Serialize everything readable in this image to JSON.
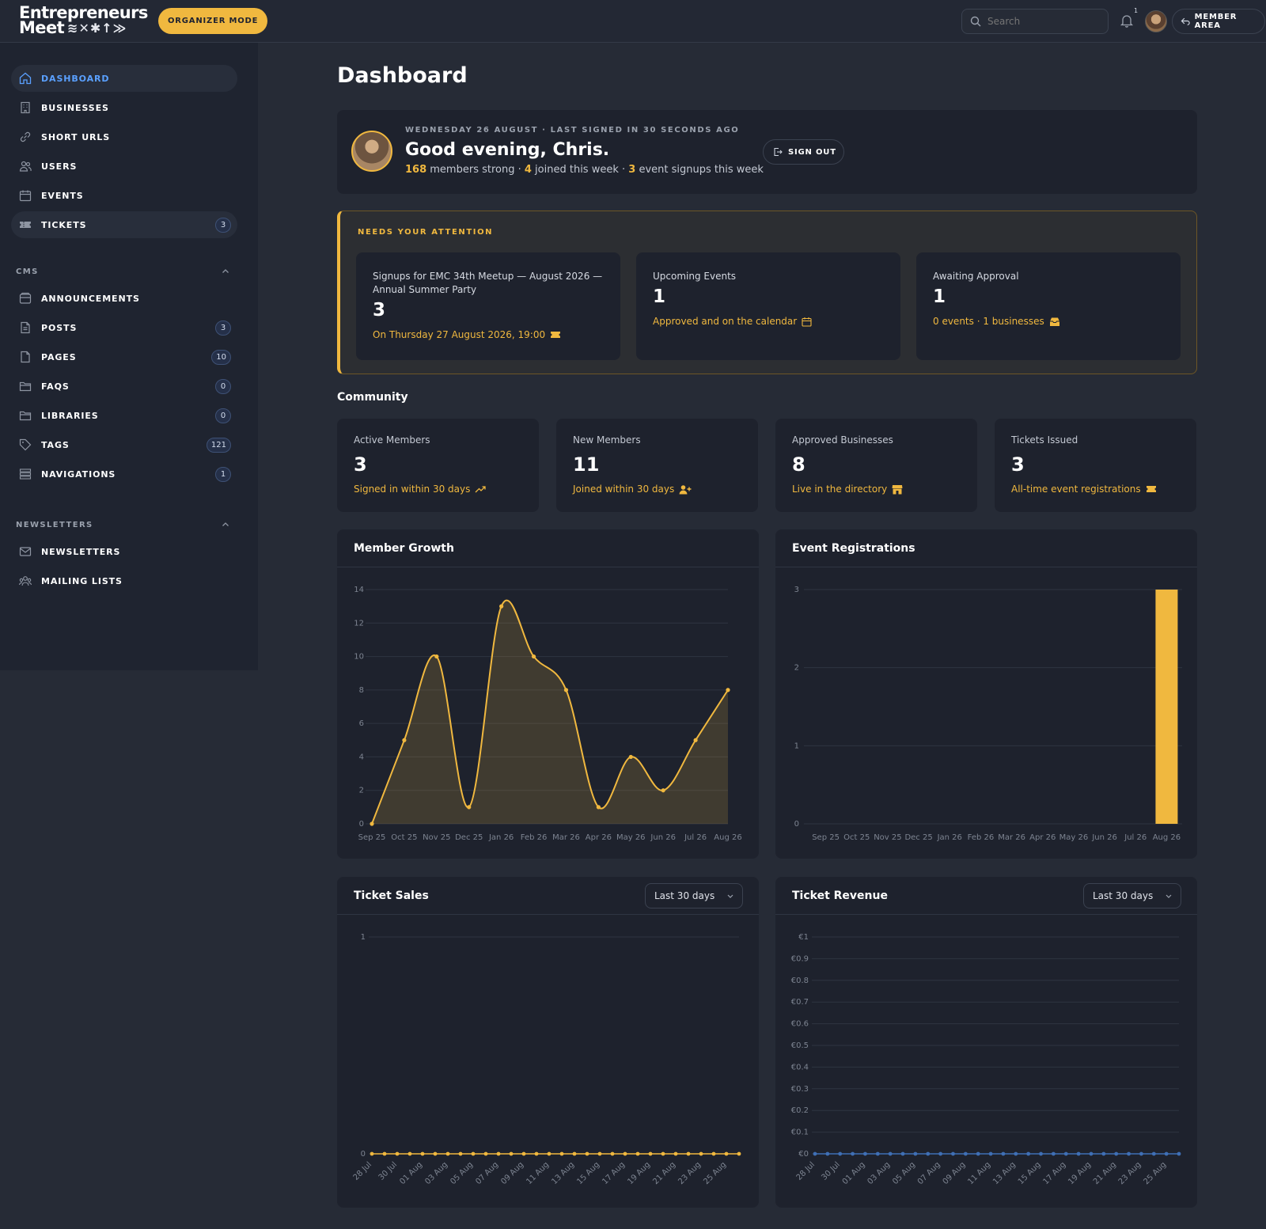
{
  "topbar": {
    "logo_line1": "Entrepreneurs",
    "logo_line2": "Meet",
    "logo_marks": "≋✕✱↑≫",
    "organizer_label": "ORGANIZER MODE",
    "search_placeholder": "Search",
    "notification_count": "1",
    "member_area_label": "MEMBER AREA"
  },
  "sidebar": {
    "main": [
      {
        "label": "DASHBOARD",
        "icon": "home-icon"
      },
      {
        "label": "BUSINESSES",
        "icon": "building-icon"
      },
      {
        "label": "SHORT URLS",
        "icon": "link-icon"
      },
      {
        "label": "USERS",
        "icon": "users-icon"
      },
      {
        "label": "EVENTS",
        "icon": "calendar-icon"
      },
      {
        "label": "TICKETS",
        "icon": "ticket-icon",
        "badge": "3"
      }
    ],
    "cms_heading": "CMS",
    "cms": [
      {
        "label": "ANNOUNCEMENTS",
        "icon": "inbox-icon"
      },
      {
        "label": "POSTS",
        "icon": "document-icon",
        "badge": "3"
      },
      {
        "label": "PAGES",
        "icon": "page-icon",
        "badge": "10"
      },
      {
        "label": "FAQS",
        "icon": "folder-icon",
        "badge": "0"
      },
      {
        "label": "LIBRARIES",
        "icon": "folder-icon",
        "badge": "0"
      },
      {
        "label": "TAGS",
        "icon": "tag-icon",
        "badge": "121"
      },
      {
        "label": "NAVIGATIONS",
        "icon": "list-icon",
        "badge": "1"
      }
    ],
    "newsletters_heading": "NEWSLETTERS",
    "newsletters": [
      {
        "label": "NEWSLETTERS",
        "icon": "mail-icon"
      },
      {
        "label": "MAILING LISTS",
        "icon": "group-icon"
      }
    ]
  },
  "main": {
    "title": "Dashboard",
    "welcome": {
      "kicker": "WEDNESDAY 26 AUGUST · LAST SIGNED IN 30 SECONDS AGO",
      "greeting": "Good evening, Chris.",
      "members": "168",
      "members_text": " members strong · ",
      "joined": "4",
      "joined_text": " joined this week · ",
      "signups": "3",
      "signups_text": " event signups this week",
      "sign_out_label": "SIGN OUT"
    },
    "attention": {
      "title": "NEEDS YOUR ATTENTION",
      "cards": [
        {
          "label": "Signups for EMC 34th Meetup — August 2026 — Annual Summer Party",
          "value": "3",
          "sub": "On Thursday 27 August 2026, 19:00",
          "icon": "ticket-icon"
        },
        {
          "label": "Upcoming Events",
          "value": "1",
          "sub": "Approved and on the calendar",
          "icon": "calendar-icon"
        },
        {
          "label": "Awaiting Approval",
          "value": "1",
          "sub": "0 events · 1 businesses",
          "icon": "inbox-icon"
        }
      ]
    },
    "community": {
      "title": "Community",
      "stats": [
        {
          "label": "Active Members",
          "value": "3",
          "sub": "Signed in within 30 days",
          "icon": "trend-up-icon"
        },
        {
          "label": "New Members",
          "value": "11",
          "sub": "Joined within 30 days",
          "icon": "user-plus-icon"
        },
        {
          "label": "Approved Businesses",
          "value": "8",
          "sub": "Live in the directory",
          "icon": "store-icon"
        },
        {
          "label": "Tickets Issued",
          "value": "3",
          "sub": "All-time event registrations",
          "icon": "ticket-icon"
        }
      ]
    },
    "charts": {
      "member_growth_title": "Member Growth",
      "event_registrations_title": "Event Registrations",
      "ticket_sales_title": "Ticket Sales",
      "ticket_revenue_title": "Ticket Revenue",
      "range_label": "Last 30 days"
    }
  },
  "colors": {
    "accent": "#f0b83f",
    "link_active": "#5aa0ff",
    "background": "#262b36",
    "card": "#1e222d",
    "revenue_line": "#3f6fb5"
  },
  "chart_data": [
    {
      "type": "area",
      "title": "Member Growth",
      "x": [
        "Sep 25",
        "Oct 25",
        "Nov 25",
        "Dec 25",
        "Jan 26",
        "Feb 26",
        "Mar 26",
        "Apr 26",
        "May 26",
        "Jun 26",
        "Jul 26",
        "Aug 26"
      ],
      "values": [
        0,
        5,
        10,
        1,
        13,
        10,
        8,
        1,
        4,
        2,
        5,
        8
      ],
      "ylim": [
        0,
        14
      ],
      "yticks": [
        0,
        2,
        4,
        6,
        8,
        10,
        12,
        14
      ],
      "grid": true
    },
    {
      "type": "bar",
      "title": "Event Registrations",
      "categories": [
        "Sep 25",
        "Oct 25",
        "Nov 25",
        "Dec 25",
        "Jan 26",
        "Feb 26",
        "Mar 26",
        "Apr 26",
        "May 26",
        "Jun 26",
        "Jul 26",
        "Aug 26"
      ],
      "values": [
        0,
        0,
        0,
        0,
        0,
        0,
        0,
        0,
        0,
        0,
        0,
        3
      ],
      "ylim": [
        0,
        3
      ],
      "yticks": [
        0,
        1,
        2,
        3
      ],
      "grid": true
    },
    {
      "type": "line",
      "title": "Ticket Sales",
      "x": [
        "28 Jul",
        "29 Jul",
        "30 Jul",
        "31 Jul",
        "01 Aug",
        "02 Aug",
        "03 Aug",
        "04 Aug",
        "05 Aug",
        "06 Aug",
        "07 Aug",
        "08 Aug",
        "09 Aug",
        "10 Aug",
        "11 Aug",
        "12 Aug",
        "13 Aug",
        "14 Aug",
        "15 Aug",
        "16 Aug",
        "17 Aug",
        "18 Aug",
        "19 Aug",
        "20 Aug",
        "21 Aug",
        "22 Aug",
        "23 Aug",
        "24 Aug",
        "25 Aug",
        "26 Aug"
      ],
      "xticks": [
        "28 Jul",
        "30 Jul",
        "01 Aug",
        "03 Aug",
        "05 Aug",
        "07 Aug",
        "09 Aug",
        "11 Aug",
        "13 Aug",
        "15 Aug",
        "17 Aug",
        "19 Aug",
        "21 Aug",
        "23 Aug",
        "25 Aug"
      ],
      "values": [
        0,
        0,
        0,
        0,
        0,
        0,
        0,
        0,
        0,
        0,
        0,
        0,
        0,
        0,
        0,
        0,
        0,
        0,
        0,
        0,
        0,
        0,
        0,
        0,
        0,
        0,
        0,
        0,
        0,
        0
      ],
      "ylim": [
        0,
        1
      ],
      "yticks": [
        0,
        1
      ],
      "grid": true
    },
    {
      "type": "line",
      "title": "Ticket Revenue",
      "x": [
        "28 Jul",
        "29 Jul",
        "30 Jul",
        "31 Jul",
        "01 Aug",
        "02 Aug",
        "03 Aug",
        "04 Aug",
        "05 Aug",
        "06 Aug",
        "07 Aug",
        "08 Aug",
        "09 Aug",
        "10 Aug",
        "11 Aug",
        "12 Aug",
        "13 Aug",
        "14 Aug",
        "15 Aug",
        "16 Aug",
        "17 Aug",
        "18 Aug",
        "19 Aug",
        "20 Aug",
        "21 Aug",
        "22 Aug",
        "23 Aug",
        "24 Aug",
        "25 Aug",
        "26 Aug"
      ],
      "xticks": [
        "28 Jul",
        "30 Jul",
        "01 Aug",
        "03 Aug",
        "05 Aug",
        "07 Aug",
        "09 Aug",
        "11 Aug",
        "13 Aug",
        "15 Aug",
        "17 Aug",
        "19 Aug",
        "21 Aug",
        "23 Aug",
        "25 Aug"
      ],
      "values": [
        0,
        0,
        0,
        0,
        0,
        0,
        0,
        0,
        0,
        0,
        0,
        0,
        0,
        0,
        0,
        0,
        0,
        0,
        0,
        0,
        0,
        0,
        0,
        0,
        0,
        0,
        0,
        0,
        0,
        0
      ],
      "ylim": [
        0,
        1
      ],
      "yticks": [
        "€0",
        "€0.1",
        "€0.2",
        "€0.3",
        "€0.4",
        "€0.5",
        "€0.6",
        "€0.7",
        "€0.8",
        "€0.9",
        "€1"
      ],
      "grid": true
    }
  ]
}
